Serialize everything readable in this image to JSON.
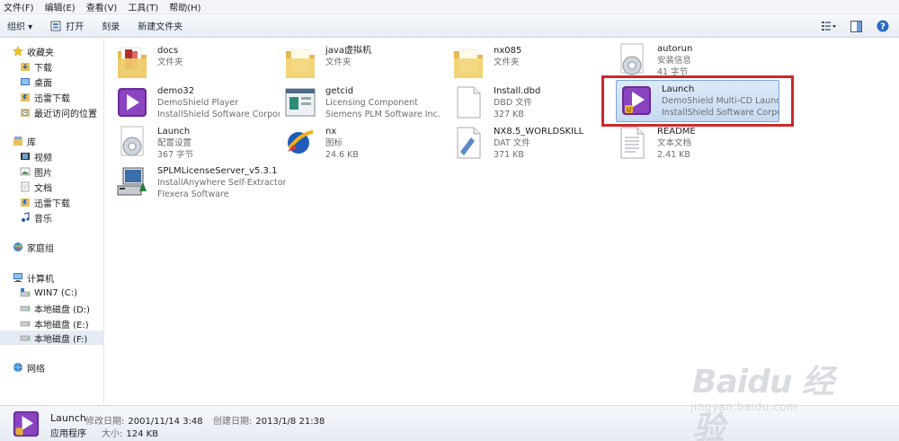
{
  "menu": [
    "文件(F)",
    "编辑(E)",
    "查看(V)",
    "工具(T)",
    "帮助(H)"
  ],
  "toolbar": {
    "organize": "组织 ▾",
    "open": "打开",
    "burn": "刻录",
    "new_folder": "新建文件夹"
  },
  "sidebar": {
    "favorites_header": "收藏夹",
    "favorites": [
      "下载",
      "桌面",
      "迅雷下载",
      "最近访问的位置"
    ],
    "libraries_header": "库",
    "libraries": [
      "视频",
      "图片",
      "文档",
      "迅雷下载",
      "音乐"
    ],
    "homegroup": "家庭组",
    "computer_header": "计算机",
    "drives": [
      "WIN7 (C:)",
      "本地磁盘 (D:)",
      "本地磁盘 (E:)",
      "本地磁盘 (F:)"
    ],
    "network": "网络"
  },
  "files": [
    {
      "name": "docs",
      "line2": "文件夹",
      "line3": ""
    },
    {
      "name": "java虚拟机",
      "line2": "文件夹",
      "line3": ""
    },
    {
      "name": "nx085",
      "line2": "文件夹",
      "line3": ""
    },
    {
      "name": "autorun",
      "line2": "安装信息",
      "line3": "41 字节"
    },
    {
      "name": "demo32",
      "line2": "DemoShield Player",
      "line3": "InstallShield Software Corpora..."
    },
    {
      "name": "getcid",
      "line2": "Licensing Component",
      "line3": "Siemens PLM Software Inc."
    },
    {
      "name": "Install.dbd",
      "line2": "DBD 文件",
      "line3": "327 KB"
    },
    {
      "name": "Launch",
      "line2": "DemoShield Multi-CD Launch",
      "line3": "InstallShield Software Corpora..."
    },
    {
      "name": "Launch",
      "line2": "配置设置",
      "line3": "367 字节"
    },
    {
      "name": "nx",
      "line2": "图标",
      "line3": "24.6 KB"
    },
    {
      "name": "NX8.5_WORLDSKILL",
      "line2": "DAT 文件",
      "line3": "371 KB"
    },
    {
      "name": "README",
      "line2": "文本文档",
      "line3": "2.41 KB"
    },
    {
      "name": "SPLMLicenseServer_v5.3.1",
      "line2": "InstallAnywhere Self-Extractor",
      "line3": "Flexera Software"
    }
  ],
  "status": {
    "name": "Launch",
    "type": "应用程序",
    "modified_label": "修改日期:",
    "modified": "2001/11/14 3:48",
    "created_label": "创建日期:",
    "created": "2013/1/8 21:38",
    "size_label": "大小:",
    "size": "124 KB"
  },
  "watermark": {
    "logo": "Baidu 经验",
    "url": "jingyan.baidu.com"
  },
  "colors": {
    "highlight": "#cc2a2a",
    "selection": "#c5dbf3",
    "toolbar": "#e8edf4"
  }
}
